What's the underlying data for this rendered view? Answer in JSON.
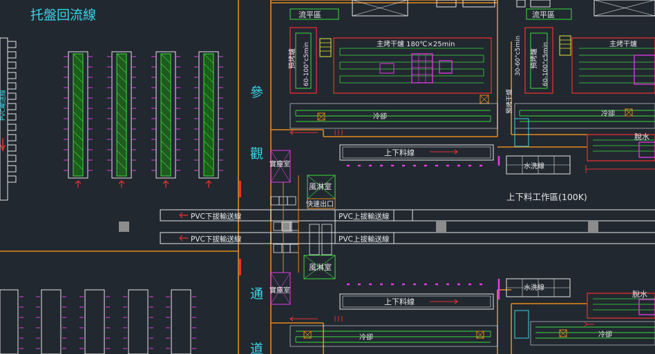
{
  "colors": {
    "bg": "#212830",
    "orange": "#e88a1a",
    "white": "#e8e8e8",
    "cyan": "#3ad6e8",
    "green": "#3ddc3d",
    "magenta": "#e83ae8",
    "red": "#e83030",
    "yellow": "#e8e83a",
    "gray": "#8c8c8c"
  },
  "labels": {
    "pallet_return_line": "托盤回流線",
    "visitor_corridor": [
      "參",
      "觀",
      "通",
      "道"
    ],
    "dust_room_top": "實塵室",
    "dust_room_bottom": "實塵室",
    "wind_shower_top": "風淋室",
    "wind_shower_bottom": "風淋室",
    "quick_exit": "快速出口",
    "pvc_down_1": "PVC下拔輸送線",
    "pvc_down_2": "PVC下拔輸送線",
    "pvc_up_1": "PVC上拔輸送線",
    "pvc_up_2": "PVC上拔輸送線",
    "load_line_top": "上下料線",
    "load_line_bottom": "上下料線",
    "work_area": "上下料工作區(100K)",
    "water_wash_top": "水洗線",
    "water_wash_bottom": "水洗線",
    "cooling_left_top": "冷卻",
    "cooling_right_top": "冷卻",
    "cooling_bottom_left": "冷卻",
    "cooling_bottom_right": "冷卻",
    "dewater_top": "脫水",
    "dewater_bottom": "脫水",
    "flow_leveling_left": "流平區",
    "flow_leveling_right": "流平區",
    "main_oven_left": "主烤干爐 180℃×25min",
    "main_oven_right": "主烤干爐",
    "preheat_left_a": "預烤爐",
    "preheat_left_b": "60-100°c5min",
    "preheat_right_a": "預烤爐",
    "preheat_right_b": "60-100°c5min",
    "preheat_right_c": "30-60°c5min",
    "preheat_right_d": "預烤干爐",
    "pvc_side_left": "PVC輸送線"
  }
}
